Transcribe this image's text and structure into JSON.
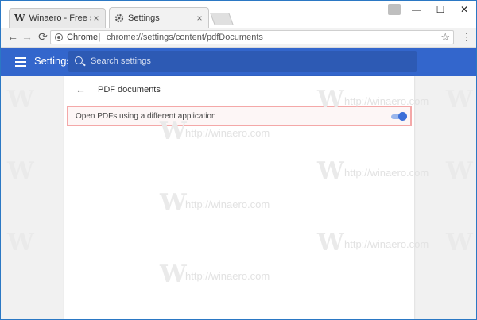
{
  "tabs": [
    {
      "label": "Winaero - Free small and",
      "favicon": "W",
      "close": "×"
    },
    {
      "label": "Settings",
      "favicon": "gear-icon",
      "close": "×"
    }
  ],
  "window_controls": {
    "minimize": "—",
    "maximize": "☐",
    "close": "✕"
  },
  "omnibox": {
    "chip": "Chrome",
    "separator": "|",
    "url": "chrome://settings/content/pdfDocuments",
    "star": "☆"
  },
  "nav": {
    "back": "←",
    "forward": "→",
    "reload": "⟳",
    "menu": "⋮"
  },
  "appbar": {
    "title": "Settings",
    "search_placeholder": "Search settings",
    "color": "#3366cc"
  },
  "page": {
    "back_arrow": "←",
    "title": "PDF documents",
    "setting_label": "Open PDFs using a different application",
    "toggle_on": true
  },
  "watermark": {
    "text": "http://winaero.com",
    "letter": "W"
  }
}
